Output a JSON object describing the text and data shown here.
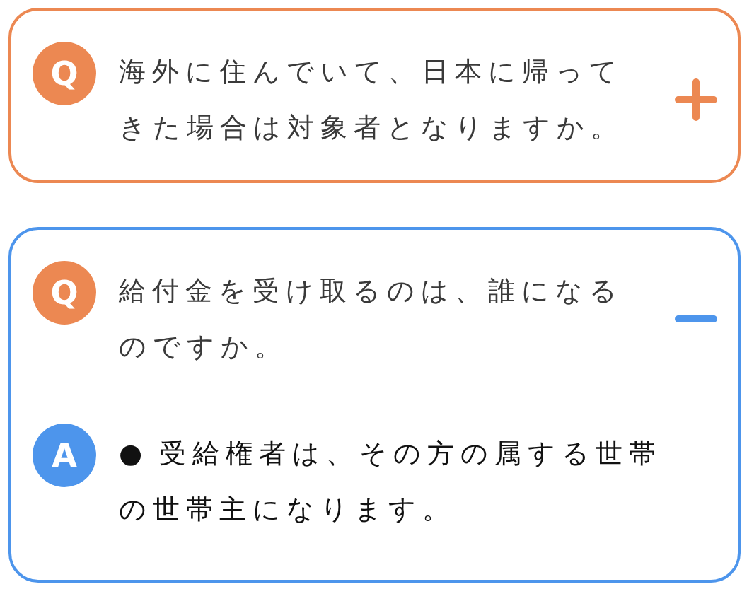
{
  "faq": [
    {
      "q_badge": "Q",
      "question": "海外に住んでいて、日本に帰ってきた場合は対象者となりますか。",
      "expanded": false
    },
    {
      "q_badge": "Q",
      "question": "給付金を受け取るのは、誰になるのですか。",
      "expanded": true,
      "a_badge": "A",
      "answer": [
        {
          "bullet": "●",
          "text": "受給権者は、その方の属する世帯の世帯主になります。"
        }
      ]
    }
  ]
}
